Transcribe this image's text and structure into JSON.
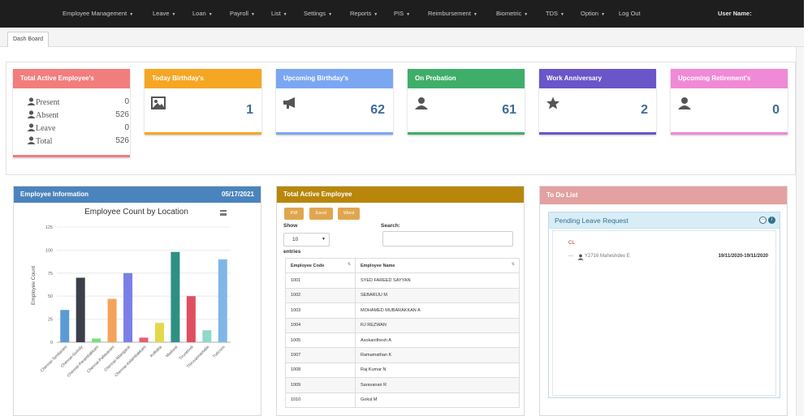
{
  "nav": {
    "items": [
      {
        "label": "Employee Management",
        "caret": true
      },
      {
        "label": "Leave",
        "caret": true
      },
      {
        "label": "Loan",
        "caret": true
      },
      {
        "label": "Payroll",
        "caret": true
      },
      {
        "label": "List",
        "caret": true
      },
      {
        "label": "Settings",
        "caret": true
      },
      {
        "label": "Reports",
        "caret": true
      },
      {
        "label": "PIS",
        "caret": true
      },
      {
        "label": "Reimbursement",
        "caret": true
      },
      {
        "label": "Biometric",
        "caret": true
      },
      {
        "label": "TDS",
        "caret": true
      },
      {
        "label": "Option",
        "caret": true
      },
      {
        "label": "Log Out",
        "caret": false
      }
    ],
    "user_label": "User Name:"
  },
  "tab": {
    "label": "Dash Board"
  },
  "cards": {
    "total_active": {
      "title": "Total Active Employee's",
      "color": "#f27d7d",
      "rows": [
        {
          "label": "Present",
          "value": "0"
        },
        {
          "label": "Absent",
          "value": "526"
        },
        {
          "label": "Leave",
          "value": "0"
        },
        {
          "label": "Total",
          "value": "526"
        }
      ]
    },
    "today_birthday": {
      "title": "Today Birthday's",
      "value": "1",
      "icon": "image-icon",
      "color": "#f5a623"
    },
    "upcoming_birthday": {
      "title": "Upcoming Birthday's",
      "value": "62",
      "icon": "megaphone-icon",
      "color": "#7ba7f2"
    },
    "on_probation": {
      "title": "On Probation",
      "value": "61",
      "icon": "user-icon",
      "color": "#3fae6a"
    },
    "work_anniversary": {
      "title": "Work Anniversary",
      "value": "2",
      "icon": "star-icon",
      "color": "#6a55c9"
    },
    "upcoming_retirement": {
      "title": "Upcoming Retirement's",
      "value": "0",
      "icon": "user-icon",
      "color": "#f08ad6"
    }
  },
  "employee_info": {
    "title": "Employee Information",
    "date": "05/17/2021",
    "color": "#4b84bd"
  },
  "chart_data": {
    "type": "bar",
    "title": "Employee Count by Location",
    "ylabel": "Employee Count",
    "xlabel": "",
    "ylim": [
      0,
      125
    ],
    "yticks": [
      "0",
      "25",
      "50",
      "75",
      "100",
      "125"
    ],
    "categories": [
      "Chennai-Tambaram",
      "Chennai-Guindy",
      "Chennai-Perambakkam",
      "Chennai-Pallavaram",
      "Chennai-Nilangarai",
      "Chennai-Kelambakkam",
      "Kolkatta",
      "Madurai",
      "Tirunelveli",
      "Thiruvannamalai",
      "Tuticorin"
    ],
    "values": [
      35,
      70,
      4,
      47,
      75,
      5,
      21,
      98,
      50,
      13,
      90
    ],
    "colors": [
      "#5b9bd5",
      "#3a3f4a",
      "#7be07b",
      "#f5a35c",
      "#7b7fe8",
      "#e85c7a",
      "#e3d94a",
      "#2f8f83",
      "#e04f5f",
      "#8fd9c9",
      "#7fb6e8"
    ]
  },
  "total_active_table": {
    "title": "Total Active Employee",
    "color": "#b8860b",
    "buttons": [
      "Pdf",
      "Excel",
      "Word"
    ],
    "show_label": "Show",
    "show_value": "10",
    "entries_label": "entries",
    "search_label": "Search:",
    "columns": [
      "Employee Code",
      "Employee Name"
    ],
    "rows": [
      [
        "1001",
        "SYED FAREED SAYYAN"
      ],
      [
        "1002",
        "SEBARIJU M"
      ],
      [
        "1003",
        "MOHAMED MUBARAKKAN A"
      ],
      [
        "1004",
        "RJ REZWAN"
      ],
      [
        "1005",
        "Asokanithesh A"
      ],
      [
        "1007",
        "Ramamathan K"
      ],
      [
        "1008",
        "Raj Kumar N"
      ],
      [
        "1009",
        "Saravanan R"
      ],
      [
        "1010",
        "Gokul M"
      ]
    ]
  },
  "todo": {
    "title": "To Do List",
    "color": "#e3a1a1",
    "pending": {
      "title": "Pending Leave Request",
      "group": "CL",
      "entries": [
        {
          "name": "Y2716 Maheshdev E",
          "dates": "19/11/2020-19/11/2020"
        }
      ]
    }
  }
}
